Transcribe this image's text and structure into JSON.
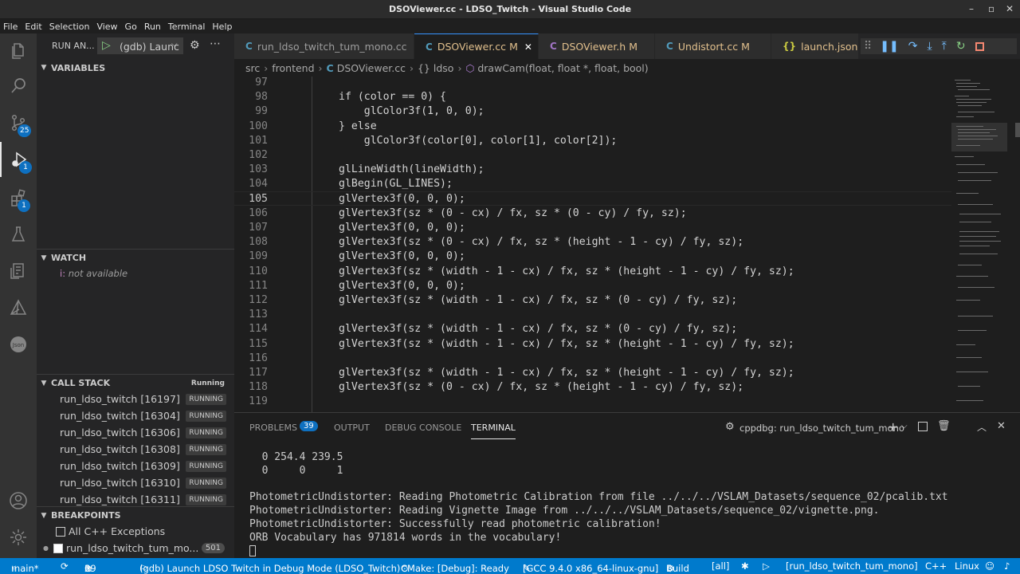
{
  "window_title": "DSOViewer.cc - LDSO_Twitch - Visual Studio Code",
  "menu": [
    "File",
    "Edit",
    "Selection",
    "View",
    "Go",
    "Run",
    "Terminal",
    "Help"
  ],
  "activity_badges": {
    "scm": "25",
    "debug": "1",
    "extensions": "1"
  },
  "sidebar": {
    "run_label": "RUN AN...",
    "launch_config": "(gdb) Launc",
    "variables_title": "VARIABLES",
    "watch_title": "WATCH",
    "watch_item_key": "i:",
    "watch_item_value": "not available",
    "callstack_title": "CALL STACK",
    "callstack_status": "Running",
    "threads": [
      {
        "name": "run_ldso_twitch [16197]",
        "state": "RUNNING"
      },
      {
        "name": "run_ldso_twitch [16304]",
        "state": "RUNNING"
      },
      {
        "name": "run_ldso_twitch [16306]",
        "state": "RUNNING"
      },
      {
        "name": "run_ldso_twitch [16308]",
        "state": "RUNNING"
      },
      {
        "name": "run_ldso_twitch [16309]",
        "state": "RUNNING"
      },
      {
        "name": "run_ldso_twitch [16310]",
        "state": "RUNNING"
      },
      {
        "name": "run_ldso_twitch [16311]",
        "state": "RUNNING"
      }
    ],
    "breakpoints_title": "BREAKPOINTS",
    "bp_exceptions": "All C++ Exceptions",
    "bp_file": "run_ldso_twitch_tum_mo...",
    "bp_file_count": "501"
  },
  "tabs": [
    {
      "icon": "C",
      "label": "run_ldso_twitch_tum_mono.cc",
      "mod": ""
    },
    {
      "icon": "C",
      "label": "DSOViewer.cc",
      "mod": "M"
    },
    {
      "icon": "C",
      "label": "DSOViewer.h",
      "mod": "M"
    },
    {
      "icon": "C",
      "label": "Undistort.cc",
      "mod": "M"
    },
    {
      "icon": "{}",
      "label": "launch.json",
      "mod": "M"
    }
  ],
  "breadcrumb": {
    "seg1": "src",
    "seg2": "frontend",
    "seg3": "DSOViewer.cc",
    "seg4": "{} ldso",
    "seg5": "drawCam(float, float *, float, bool)"
  },
  "line_numbers": [
    "97",
    "98",
    "99",
    "100",
    "101",
    "102",
    "103",
    "104",
    "105",
    "106",
    "107",
    "108",
    "109",
    "110",
    "111",
    "112",
    "113",
    "114",
    "115",
    "116",
    "117",
    "118",
    "119"
  ],
  "code_lines": [
    "",
    "if (color == 0) {",
    "    glColor3f(1, 0, 0);",
    "} else",
    "    glColor3f(color[0], color[1], color[2]);",
    "",
    "glLineWidth(lineWidth);",
    "glBegin(GL_LINES);",
    "glVertex3f(0, 0, 0);",
    "glVertex3f(sz * (0 - cx) / fx, sz * (0 - cy) / fy, sz);",
    "glVertex3f(0, 0, 0);",
    "glVertex3f(sz * (0 - cx) / fx, sz * (height - 1 - cy) / fy, sz);",
    "glVertex3f(0, 0, 0);",
    "glVertex3f(sz * (width - 1 - cx) / fx, sz * (height - 1 - cy) / fy, sz);",
    "glVertex3f(0, 0, 0);",
    "glVertex3f(sz * (width - 1 - cx) / fx, sz * (0 - cy) / fy, sz);",
    "",
    "glVertex3f(sz * (width - 1 - cx) / fx, sz * (0 - cy) / fy, sz);",
    "glVertex3f(sz * (width - 1 - cx) / fx, sz * (height - 1 - cy) / fy, sz);",
    "",
    "glVertex3f(sz * (width - 1 - cx) / fx, sz * (height - 1 - cy) / fy, sz);",
    "glVertex3f(sz * (0 - cx) / fx, sz * (height - 1 - cy) / fy, sz);",
    ""
  ],
  "panel": {
    "problems": "PROBLEMS",
    "problems_count": "39",
    "output": "OUTPUT",
    "debug_console": "DEBUG CONSOLE",
    "terminal": "TERMINAL",
    "terminal_name": "cppdbg: run_ldso_twitch_tum_mono",
    "terminal_lines": [
      "  0 254.4 239.5",
      "  0     0     1",
      "",
      "PhotometricUndistorter: Reading Photometric Calibration from file ../../../VSLAM_Datasets/sequence_02/pcalib.txt",
      "PhotometricUndistorter: Reading Vignette Image from ../../../VSLAM_Datasets/sequence_02/vignette.png.",
      "PhotometricUndistorter: Successfully read photometric calibration!",
      "ORB Vocabulary has 971814 words in the vocabulary!"
    ]
  },
  "status": {
    "branch": "main*",
    "errors": "0",
    "warnings": "39",
    "debug": "(gdb) Launch LDSO Twitch in Debug Mode (LDSO_Twitch)",
    "cmake": "CMake: [Debug]: Ready",
    "kit": "[GCC 9.4.0 x86_64-linux-gnu]",
    "build": "Build",
    "target": "[all]",
    "launch_target": "[run_ldso_twitch_tum_mono]",
    "lang": "C++",
    "os": "Linux"
  }
}
